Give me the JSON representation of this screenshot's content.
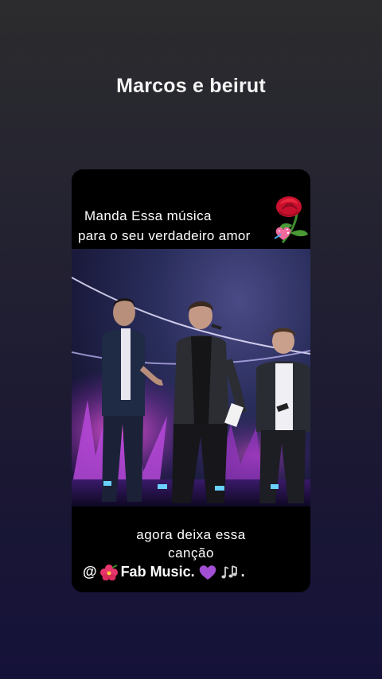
{
  "story": {
    "title": "Marcos e beirut"
  },
  "card": {
    "top_caption": {
      "line1": "Manda Essa música",
      "line2": "para o seu verdadeiro amor"
    },
    "bottom_caption": {
      "line1": "agora deixa essa",
      "line2": "canção"
    },
    "credit": {
      "at": "@",
      "name": "Fab Music.",
      "suffix": "."
    },
    "icons": [
      "rose-icon",
      "sparkling-heart-icon",
      "hibiscus-icon",
      "purple-heart-icon",
      "music-notes-icon"
    ],
    "colors": {
      "background_top": "#2c2c2e",
      "background_bottom": "#15123a",
      "card": "#000000",
      "stage_light": "#b548d8"
    }
  }
}
